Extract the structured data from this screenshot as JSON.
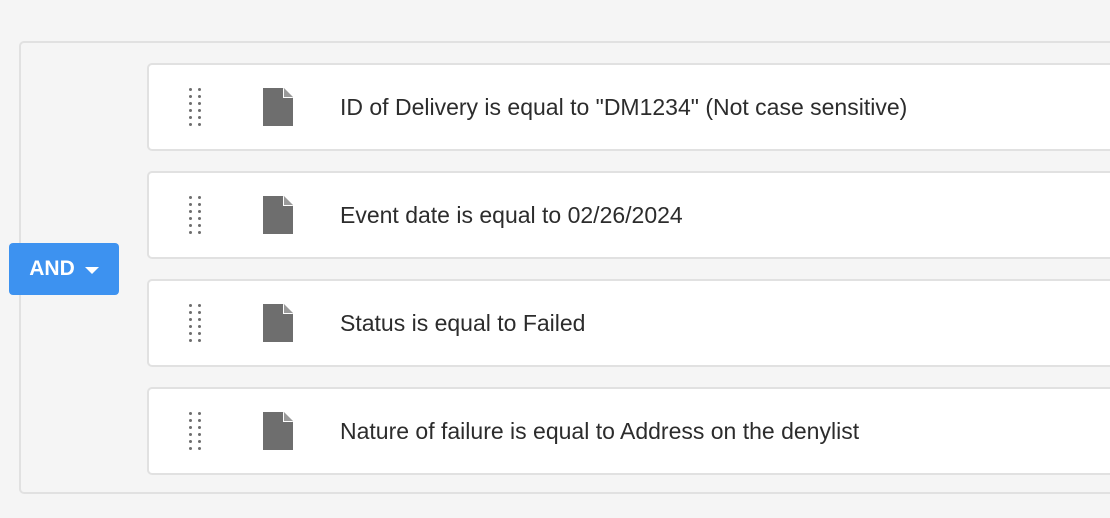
{
  "operator": {
    "label": "AND",
    "icon": "chevron-down-icon",
    "color": "#3d92f0"
  },
  "rules": [
    {
      "text": "ID of Delivery is equal to \"DM1234\" (Not case sensitive)",
      "icon": "document-icon"
    },
    {
      "text": "Event date is equal to 02/26/2024",
      "icon": "document-icon"
    },
    {
      "text": "Status is equal to Failed",
      "icon": "document-icon"
    },
    {
      "text": "Nature of failure is equal to Address on the denylist",
      "icon": "document-icon"
    }
  ]
}
